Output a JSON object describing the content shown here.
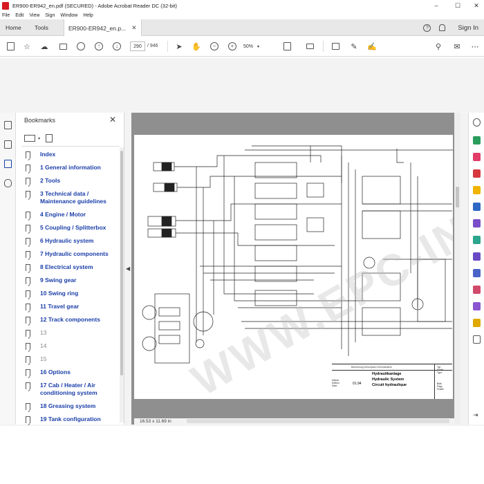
{
  "window": {
    "title": "ER900-ER942_en.pdf (SECURED) - Adobe Acrobat Reader DC (32-bit)",
    "minimize": "–",
    "maximize": "☐",
    "close": "✕"
  },
  "menu": [
    "File",
    "Edit",
    "View",
    "Sign",
    "Window",
    "Help"
  ],
  "tabs": {
    "home": "Home",
    "tools": "Tools",
    "document": "ER900-ER942_en.p...",
    "document_close": "✕",
    "help": "?",
    "signin": "Sign In"
  },
  "toolbar": {
    "page_current": "290",
    "page_total": "/ 946",
    "zoom": "50%"
  },
  "bookmarks": {
    "title": "Bookmarks",
    "close": "✕",
    "items": [
      {
        "label": "Index",
        "dim": false
      },
      {
        "label": "1 General information",
        "dim": false
      },
      {
        "label": "2 Tools",
        "dim": false
      },
      {
        "label": "3 Technical data / Maintenance guidelines",
        "dim": false
      },
      {
        "label": "4 Engine / Motor",
        "dim": false
      },
      {
        "label": "5 Coupling / Splitterbox",
        "dim": false
      },
      {
        "label": "6 Hydraulic system",
        "dim": false
      },
      {
        "label": "7 Hydraulic components",
        "dim": false
      },
      {
        "label": "8 Electrical system",
        "dim": false
      },
      {
        "label": "9 Swing gear",
        "dim": false
      },
      {
        "label": "10 Swing ring",
        "dim": false
      },
      {
        "label": "11 Travel gear",
        "dim": false
      },
      {
        "label": "12 Track components",
        "dim": false
      },
      {
        "label": "13",
        "dim": true
      },
      {
        "label": "14",
        "dim": true
      },
      {
        "label": "15",
        "dim": true
      },
      {
        "label": "16 Options",
        "dim": false
      },
      {
        "label": "17 Cab / Heater / Air conditioning system",
        "dim": false
      },
      {
        "label": "18 Greasing system",
        "dim": false
      },
      {
        "label": "19 Tank configuration",
        "dim": false
      }
    ]
  },
  "document": {
    "watermark": "WWW.EPC-INFO.COM",
    "titleblock": {
      "description": "Benennung Description Dénomination",
      "line1": "Hydraulikanlage",
      "line2": "Hydraulic System",
      "line3": "Circuit hydraulique",
      "date_label": "Datum\nEdition\nDate",
      "date": "01.94",
      "right": "Typ\nModel\nType",
      "right2": "Blatt\nPage\nFeuille"
    },
    "page_size": "16.53 x 11.69 in"
  },
  "colors": {
    "link": "#1a3ea8",
    "dim": "#8a8a8a",
    "acrobat_red": "#d71920"
  }
}
